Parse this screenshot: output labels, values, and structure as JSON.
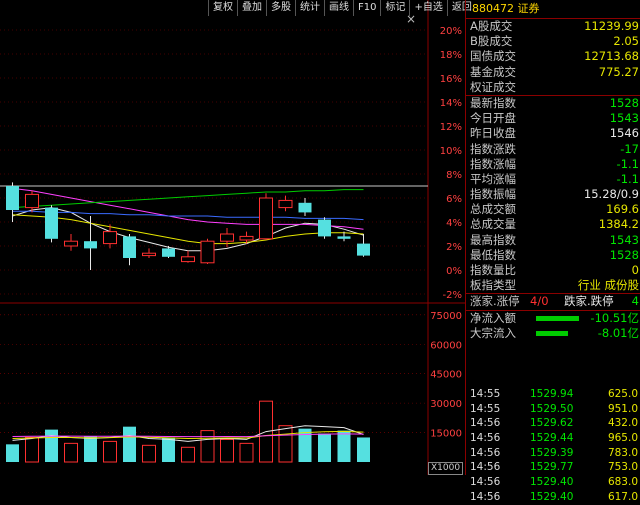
{
  "toolbar": {
    "buttons": [
      "复权",
      "叠加",
      "多股",
      "统计",
      "画线",
      "F10",
      "标记",
      "+自选",
      "返回"
    ],
    "close": "×"
  },
  "panel": {
    "code": "880472",
    "name": "证券",
    "stats": [
      {
        "label": "A股成交",
        "value": "11239.99",
        "color": "yellow"
      },
      {
        "label": "B股成交",
        "value": "2.05",
        "color": "yellow"
      },
      {
        "label": "国债成交",
        "value": "12713.68",
        "color": "yellow"
      },
      {
        "label": "基金成交",
        "value": "775.27",
        "color": "yellow"
      },
      {
        "label": "权证成交",
        "value": "",
        "color": "yellow"
      }
    ],
    "quote": [
      {
        "label": "最新指数",
        "value": "1528",
        "color": "green"
      },
      {
        "label": "今日开盘",
        "value": "1543",
        "color": "green"
      },
      {
        "label": "昨日收盘",
        "value": "1546",
        "color": "white"
      },
      {
        "label": "指数涨跌",
        "value": "-17",
        "color": "green"
      },
      {
        "label": "指数涨幅",
        "value": "-1.1",
        "color": "green"
      },
      {
        "label": "平均涨幅",
        "value": "-1.1",
        "color": "green"
      },
      {
        "label": "指数振幅",
        "value": "15.28/0.9",
        "color": "white"
      },
      {
        "label": "总成交额",
        "value": "169.6",
        "color": "yellow"
      },
      {
        "label": "总成交量",
        "value": "1384.2",
        "color": "yellow"
      },
      {
        "label": "最高指数",
        "value": "1543",
        "color": "green"
      },
      {
        "label": "最低指数",
        "value": "1528",
        "color": "green"
      },
      {
        "label": "指数量比",
        "value": "0",
        "color": "yellow"
      },
      {
        "label": "板指类型",
        "value": "行业 成份股",
        "color": "yellow"
      }
    ],
    "updown": {
      "up_label": "涨家.涨停",
      "up_value": "4/0",
      "down_label": "跌家.跌停",
      "down_value": "4"
    },
    "flows": [
      {
        "label": "净流入额",
        "value": "-10.51亿",
        "bar_fraction": 0.62
      },
      {
        "label": "大宗流入",
        "value": "-8.01亿",
        "bar_fraction": 0.46
      }
    ],
    "ticks": [
      {
        "time": "14:55",
        "price": "1529.94",
        "vol": "625.0"
      },
      {
        "time": "14:55",
        "price": "1529.50",
        "vol": "951.0"
      },
      {
        "time": "14:56",
        "price": "1529.62",
        "vol": "432.0"
      },
      {
        "time": "14:56",
        "price": "1529.44",
        "vol": "965.0"
      },
      {
        "time": "14:56",
        "price": "1529.39",
        "vol": "783.0"
      },
      {
        "time": "14:56",
        "price": "1529.77",
        "vol": "753.0"
      },
      {
        "time": "14:56",
        "price": "1529.40",
        "vol": "683.0"
      },
      {
        "time": "14:56",
        "price": "1529.40",
        "vol": "617.0"
      }
    ]
  },
  "chart_data": {
    "type": "candlestick",
    "price_axis": {
      "unit": "%",
      "ticks": [
        "20%",
        "18%",
        "16%",
        "14%",
        "12%",
        "10%",
        "8%",
        "6%",
        "4%",
        "2%",
        "0%",
        "-2%"
      ],
      "ylim": [
        -2.5,
        21
      ]
    },
    "volume_axis": {
      "ticks": [
        "75000",
        "60000",
        "45000",
        "30000",
        "15000"
      ],
      "ylim": [
        0,
        80000
      ]
    },
    "volume_scale_label": "X1000",
    "reference_line_pct": 7.0,
    "candles": [
      {
        "o": 7.0,
        "c": 5.0,
        "h": 7.3,
        "l": 4.0,
        "v": 9000
      },
      {
        "o": 5.2,
        "c": 6.3,
        "h": 6.6,
        "l": 4.8,
        "v": 12500
      },
      {
        "o": 5.2,
        "c": 2.6,
        "h": 5.4,
        "l": 2.3,
        "v": 16500
      },
      {
        "o": 2.0,
        "c": 2.4,
        "h": 3.0,
        "l": 1.6,
        "v": 9500
      },
      {
        "o": 2.4,
        "c": 1.8,
        "h": 4.5,
        "l": 0.0,
        "v": 13000
      },
      {
        "o": 2.2,
        "c": 3.2,
        "h": 3.8,
        "l": 1.8,
        "v": 10500
      },
      {
        "o": 2.8,
        "c": 1.0,
        "h": 3.0,
        "l": 0.4,
        "v": 18000
      },
      {
        "o": 1.2,
        "c": 1.4,
        "h": 1.8,
        "l": 1.0,
        "v": 8500
      },
      {
        "o": 1.8,
        "c": 1.1,
        "h": 2.0,
        "l": 1.0,
        "v": 12500
      },
      {
        "o": 0.7,
        "c": 1.1,
        "h": 1.6,
        "l": 0.6,
        "v": 7500
      },
      {
        "o": 0.6,
        "c": 2.4,
        "h": 2.6,
        "l": 0.5,
        "v": 16000
      },
      {
        "o": 2.4,
        "c": 3.0,
        "h": 3.5,
        "l": 1.9,
        "v": 11500
      },
      {
        "o": 2.5,
        "c": 2.8,
        "h": 3.2,
        "l": 2.2,
        "v": 9500
      },
      {
        "o": 2.6,
        "c": 6.0,
        "h": 6.4,
        "l": 2.5,
        "v": 31000
      },
      {
        "o": 5.2,
        "c": 5.8,
        "h": 6.2,
        "l": 4.9,
        "v": 18500
      },
      {
        "o": 5.6,
        "c": 4.8,
        "h": 6.0,
        "l": 4.5,
        "v": 17000
      },
      {
        "o": 4.2,
        "c": 2.8,
        "h": 4.4,
        "l": 2.6,
        "v": 14500
      },
      {
        "o": 2.8,
        "c": 2.6,
        "h": 3.2,
        "l": 2.4,
        "v": 16000
      },
      {
        "o": 2.2,
        "c": 1.2,
        "h": 3.0,
        "l": 1.1,
        "v": 12500
      }
    ],
    "ma_lines": [
      {
        "color": "#e8e8e8",
        "values": [
          4.5,
          5.0,
          5.2,
          4.8,
          3.9,
          3.2,
          2.7,
          2.3,
          1.9,
          1.6,
          1.6,
          1.8,
          2.2,
          2.8,
          3.5,
          3.9,
          3.8,
          3.4,
          2.9
        ]
      },
      {
        "color": "#e6e600",
        "values": [
          4.6,
          4.5,
          4.4,
          4.2,
          3.9,
          3.6,
          3.3,
          3.0,
          2.7,
          2.4,
          2.2,
          2.2,
          2.3,
          2.5,
          2.8,
          3.0,
          3.1,
          3.1,
          3.0
        ]
      },
      {
        "color": "#ff40ff",
        "values": [
          6.8,
          6.6,
          6.3,
          6.0,
          5.7,
          5.4,
          5.1,
          4.8,
          4.5,
          4.2,
          4.0,
          3.9,
          3.8,
          3.8,
          3.8,
          3.8,
          3.7,
          3.6,
          3.4
        ]
      },
      {
        "color": "#00cc00",
        "values": [
          5.2,
          5.3,
          5.4,
          5.5,
          5.6,
          5.7,
          5.8,
          5.9,
          6.0,
          6.1,
          6.2,
          6.3,
          6.4,
          6.5,
          6.5,
          6.6,
          6.6,
          6.7,
          6.7
        ]
      },
      {
        "color": "#3a6bff",
        "values": [
          4.9,
          4.9,
          4.8,
          4.8,
          4.7,
          4.7,
          4.6,
          4.6,
          4.5,
          4.5,
          4.5,
          4.4,
          4.4,
          4.4,
          4.4,
          4.3,
          4.3,
          4.3,
          4.2
        ]
      }
    ],
    "volume_ma": [
      {
        "color": "#e8e8e8",
        "values": [
          11000,
          12000,
          13500,
          12500,
          12000,
          12500,
          13500,
          12000,
          11500,
          10500,
          11500,
          12000,
          11500,
          15500,
          17000,
          18500,
          18000,
          17500,
          14000
        ]
      },
      {
        "color": "#e6e600",
        "values": [
          12000,
          12200,
          12500,
          12500,
          12300,
          12400,
          12800,
          12600,
          12300,
          12000,
          12100,
          12300,
          12200,
          13500,
          14200,
          15000,
          15400,
          15600,
          15200
        ]
      },
      {
        "color": "#ff40ff",
        "values": [
          13000,
          13100,
          13200,
          13200,
          13100,
          13100,
          13200,
          13100,
          13000,
          12900,
          12900,
          13000,
          12900,
          13400,
          13700,
          14000,
          14200,
          14300,
          14200
        ]
      }
    ]
  }
}
